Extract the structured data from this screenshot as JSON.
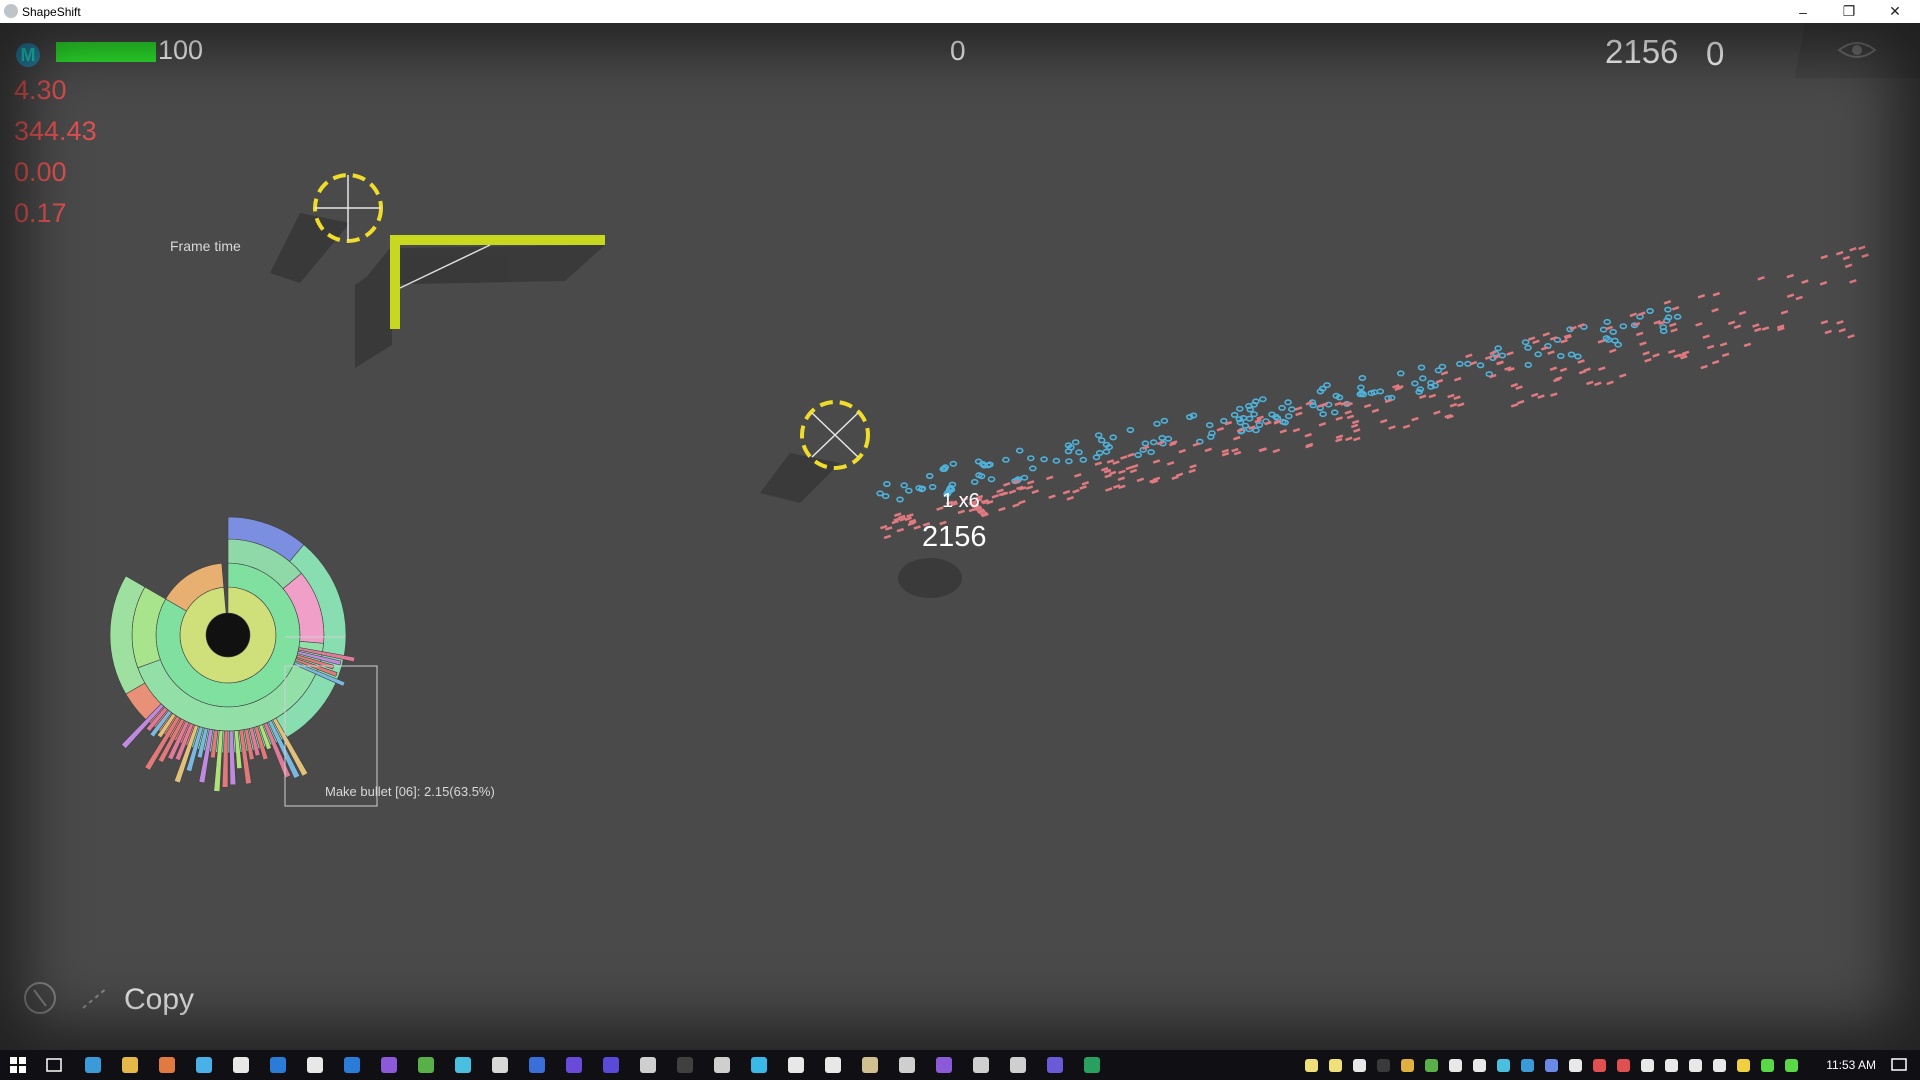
{
  "window": {
    "title": "ShapeShift",
    "minimize": "–",
    "restore": "❐",
    "close": "✕"
  },
  "hud": {
    "player_badge": "M",
    "health": 100,
    "health_fraction": 1.0,
    "center_counter": "0",
    "score": "2156",
    "score_right": "0",
    "stats": [
      "4.30",
      "344.43",
      "0.00",
      "0.17"
    ],
    "frame_time_label": "Frame time"
  },
  "world": {
    "combo_label": "1 x6",
    "floating_score": "2156",
    "profiler_tooltip": "Make bullet [06]: 2.15(63.5%)"
  },
  "bottom": {
    "copy_label": "Copy"
  },
  "taskbar": {
    "clock": "11:53 AM"
  },
  "colors": {
    "health": "#2ee82e",
    "stats": "#e05050",
    "crosshair": "#f0dc2a",
    "bullet_blue": "#4fb4dd",
    "bullet_pink": "#e07a80",
    "wall": "#c8d81e"
  },
  "icons": [
    "windows-start-icon",
    "task-view-icon",
    "eye-icon",
    "hand-cursor-icon"
  ]
}
